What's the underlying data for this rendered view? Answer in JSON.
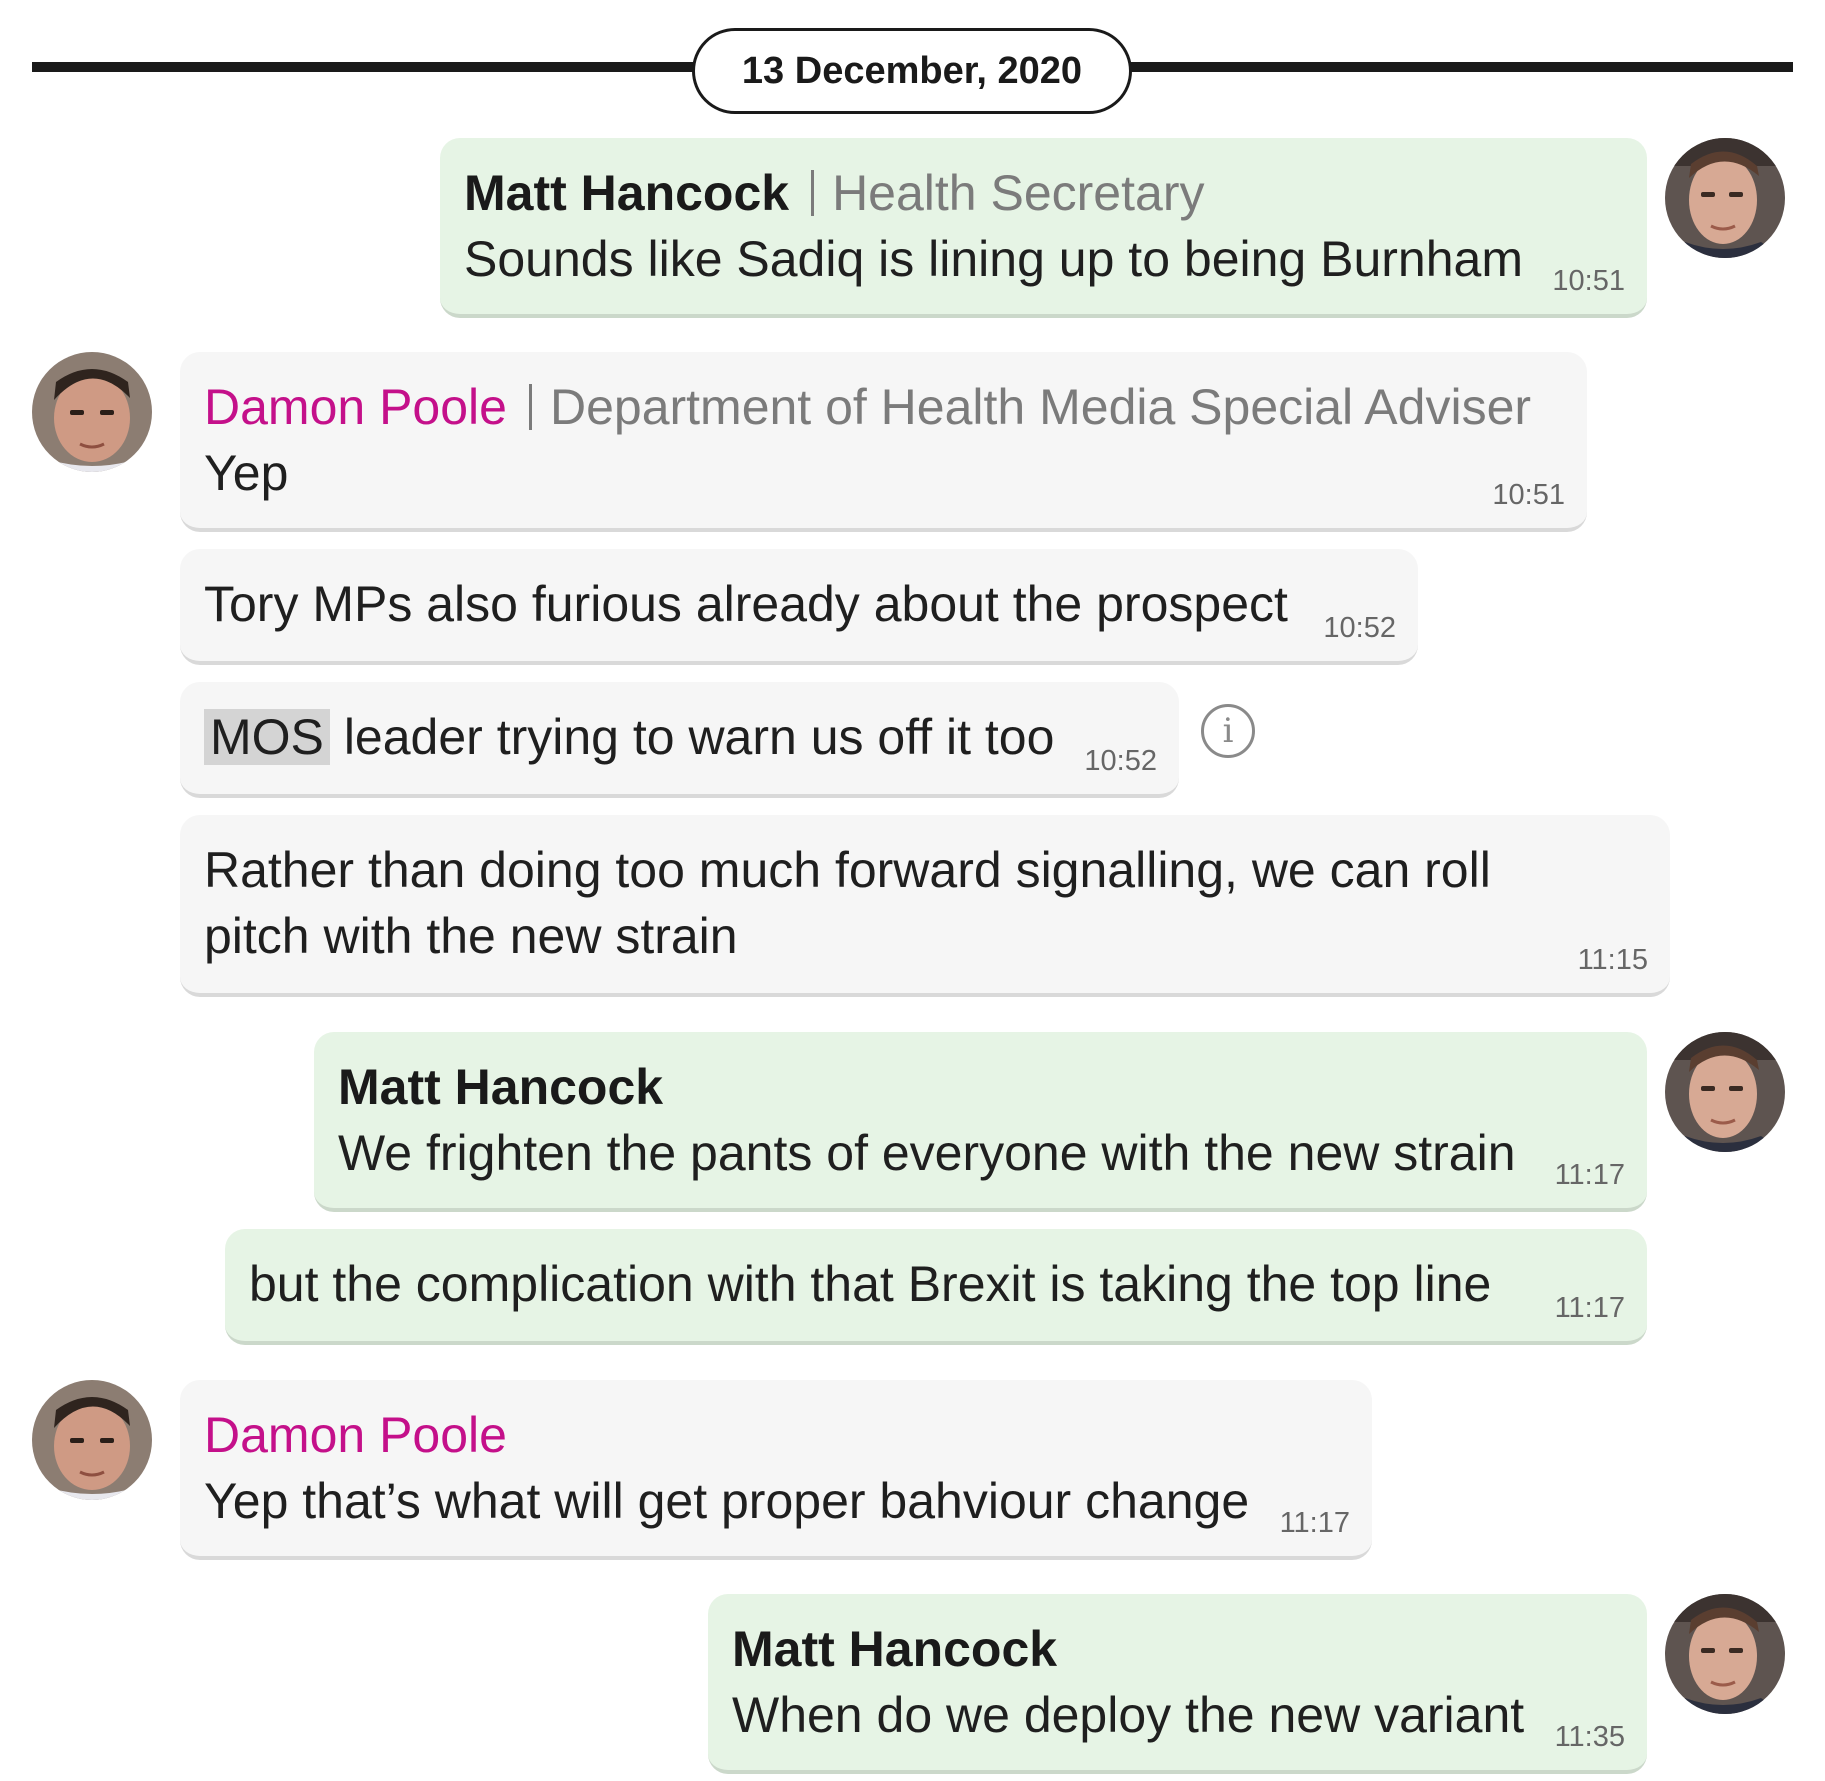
{
  "date_separator": "13 December, 2020",
  "messages": [
    {
      "sender": "Matt Hancock",
      "role": "Health Secretary",
      "text": "Sounds like Sadiq is lining up to being Burnham",
      "time": "10:51",
      "direction": "outgoing"
    },
    {
      "sender": "Damon Poole",
      "role": "Department of Health Media Special Adviser",
      "text": "Yep",
      "time": "10:51",
      "direction": "incoming"
    },
    {
      "text": "Tory MPs also furious already about the prospect",
      "time": "10:52",
      "direction": "incoming"
    },
    {
      "highlight": "MOS",
      "text": "leader trying to warn us off it too",
      "time": "10:52",
      "direction": "incoming",
      "info_icon": "i"
    },
    {
      "text": "Rather than doing too much forward signalling, we can roll pitch with the new strain",
      "time": "11:15",
      "direction": "incoming"
    },
    {
      "sender": "Matt Hancock",
      "text": "We frighten the pants of everyone with the new strain",
      "time": "11:17",
      "direction": "outgoing"
    },
    {
      "text": "but the complication with that Brexit is taking the top line",
      "time": "11:17",
      "direction": "outgoing"
    },
    {
      "sender": "Damon Poole",
      "text": "Yep that’s what will get proper bahviour change",
      "time": "11:17",
      "direction": "incoming"
    },
    {
      "sender": "Matt Hancock",
      "text": "When do we deploy the new variant",
      "time": "11:35",
      "direction": "outgoing"
    }
  ],
  "colors": {
    "outgoing_bubble": "#e6f4e5",
    "incoming_bubble": "#f6f6f6",
    "damon_name": "#c4108a",
    "role_text": "#7b7b7b"
  },
  "icons": {
    "avatar_matt": "person-photo-avatar",
    "avatar_damon": "person-photo-avatar",
    "info": "info-circle-icon"
  }
}
